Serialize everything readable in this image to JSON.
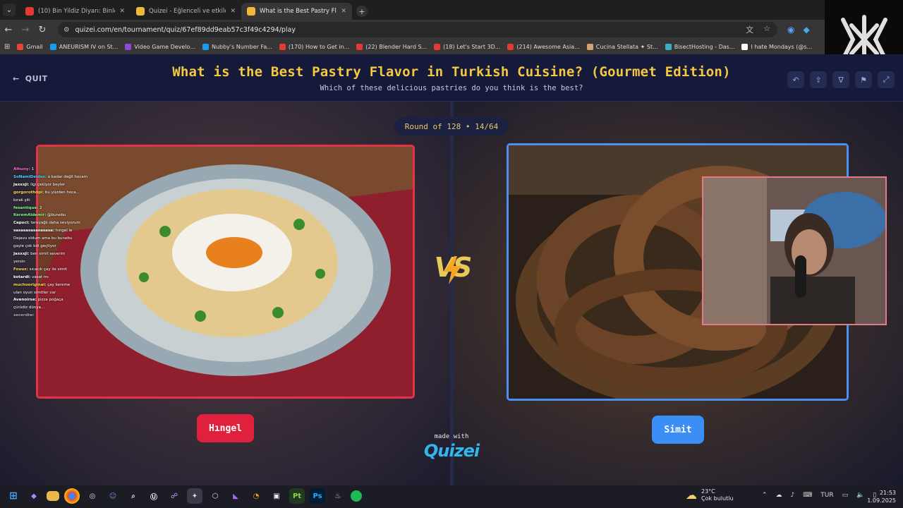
{
  "browser": {
    "tabs": [
      {
        "title": "(10) Bin Yildiz Diyarı: Binlerce Y...",
        "active": false,
        "favicon_color": "#e53935"
      },
      {
        "title": "Quizei - Eğlenceli ve etkileşimli...",
        "active": false,
        "favicon_color": "#f0b93a"
      },
      {
        "title": "What is the Best Pastry Flavor i...",
        "active": true,
        "favicon_color": "#f0b93a"
      }
    ],
    "url": "quizei.com/en/tournament/quiz/67ef89dd9eab57c3f49c4294/play",
    "bookmarks": [
      {
        "label": "Gmail",
        "color": "#ea4335"
      },
      {
        "label": "ANEURISM IV on St...",
        "color": "#1b9aee"
      },
      {
        "label": "Video Game Develo...",
        "color": "#8a4bd8"
      },
      {
        "label": "Nubby's Number Fa...",
        "color": "#1b9aee"
      },
      {
        "label": "(170) How to Get in...",
        "color": "#e53935"
      },
      {
        "label": "(22) Blender Hard S...",
        "color": "#e53935"
      },
      {
        "label": "(18) Let's Start 3D...",
        "color": "#e53935"
      },
      {
        "label": "(214) Awesome Asia...",
        "color": "#e53935"
      },
      {
        "label": "Cucina Stellata ✦ St...",
        "color": "#d4a373"
      },
      {
        "label": "BisectHosting - Das...",
        "color": "#3ab0c8"
      },
      {
        "label": "I hate Mondays (@s...",
        "color": "#ffffff"
      }
    ]
  },
  "header": {
    "quit_label": "QUIT",
    "title": "What is the Best Pastry Flavor in Turkish Cuisine? (Gourmet Edition)",
    "subtitle": "Which of these delicious pastries do you think is the best?"
  },
  "round": {
    "label": "Round of 128 • 14/64"
  },
  "vs_label": "VS",
  "choices": {
    "left": {
      "name": "Hıngel"
    },
    "right": {
      "name": "Simit"
    }
  },
  "footer": {
    "made_with": "made with",
    "brand": "Quizei"
  },
  "chat": [
    {
      "user": "Alhuny:",
      "text": "1"
    },
    {
      "user": "SoNamiDeidso:",
      "text": "o kadar değil hocam"
    },
    {
      "user": "Jaxxxji:",
      "text": "ilgi çekiyor beyler"
    },
    {
      "user": "gorgorothdpi:",
      "text": "bu yüzden hoca..."
    },
    {
      "user": "",
      "text": "bırak şiti"
    },
    {
      "user": "fesantique:",
      "text": "2"
    },
    {
      "user": "KeremAldemir:",
      "text": "@bunebu"
    },
    {
      "user": "Capoci:",
      "text": "tereyağlı daha seviyorum"
    },
    {
      "user": "sasasasasasasasa:",
      "text": "hıngel le"
    },
    {
      "user": "",
      "text": "Dejavu oldum ama bu bunebu"
    },
    {
      "user": "",
      "text": "gayle çok böl geçtiyor"
    },
    {
      "user": "Jaxxxji:",
      "text": "ben simit severim"
    },
    {
      "user": "",
      "text": "yersin"
    },
    {
      "user": "Fouux:",
      "text": "sıcacık çay ile simit"
    },
    {
      "user": "kotardi:",
      "text": "vasat mı"
    },
    {
      "user": "muchooriginal:",
      "text": "çay kereme"
    },
    {
      "user": "",
      "text": "ulan oyun simitler var"
    },
    {
      "user": "Avenoirse:",
      "text": "pizza poğaça"
    },
    {
      "user": "",
      "text": "çürüdiz dünya..."
    },
    {
      "user": "secerdiw:",
      "text": ""
    }
  ],
  "taskbar": {
    "weather_temp": "23°C",
    "weather_desc": "Çok bulutlu",
    "lang": "TUR",
    "time": "21:53",
    "date": "1.09.2025"
  }
}
